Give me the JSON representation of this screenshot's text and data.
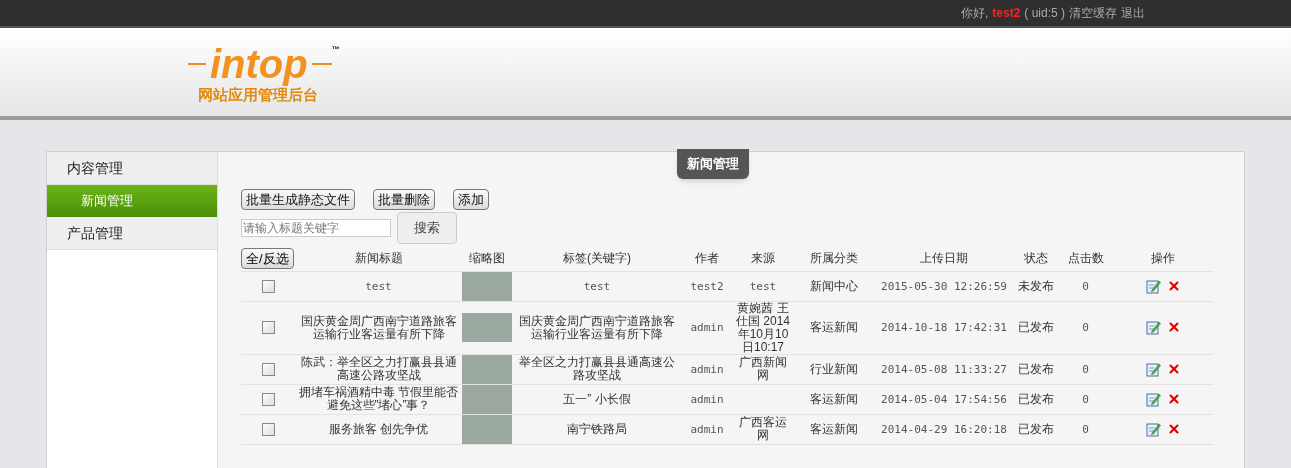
{
  "topbar": {
    "greeting": "你好,",
    "username": "test2",
    "uid": "( uid:5 )",
    "links": [
      "清空缓存",
      "退出"
    ]
  },
  "logo": {
    "name": "intop",
    "tm": "™",
    "subtitle": "网站应用管理后台"
  },
  "sidebar": {
    "groups": [
      {
        "label": "内容管理",
        "items": [
          {
            "label": "新闻管理",
            "selected": true
          }
        ]
      },
      {
        "label": "产品管理"
      }
    ]
  },
  "panel": {
    "title": "新闻管理"
  },
  "toolbar": {
    "buttons": [
      "批量生成静态文件",
      "批量删除",
      "添加"
    ],
    "search": {
      "placeholder": "请输入标题关键字",
      "button": "搜索"
    }
  },
  "table": {
    "select_all": "全/反选",
    "columns": [
      "新闻标题",
      "缩略图",
      "标签(关键字)",
      "作者",
      "来源",
      "所属分类",
      "上传日期",
      "状态",
      "点击数",
      "操作"
    ],
    "rows": [
      {
        "checked": false,
        "title": "test",
        "tags": "test",
        "author": "test2",
        "source": "test",
        "category": "新闻中心",
        "date": "2015-05-30 12:26:59",
        "status": "未发布",
        "clicks": "0"
      },
      {
        "checked": false,
        "title": "国庆黄金周广西南宁道路旅客运输行业客运量有所下降",
        "tags": "国庆黄金周广西南宁道路旅客运输行业客运量有所下降",
        "author": "admin",
        "source": "黄婉茜 王仕国 2014年10月10日10:17",
        "category": "客运新闻",
        "date": "2014-10-18 17:42:31",
        "status": "已发布",
        "clicks": "0"
      },
      {
        "checked": false,
        "title": "陈武：举全区之力打赢县县通高速公路攻坚战",
        "tags": "举全区之力打赢县县通高速公路攻坚战",
        "author": "admin",
        "source": "广西新闻网",
        "category": "行业新闻",
        "date": "2014-05-08 11:33:27",
        "status": "已发布",
        "clicks": "0"
      },
      {
        "checked": false,
        "title": "拥堵车祸酒精中毒 节假里能否避免这些”堵心”事？",
        "tags": "五一” 小长假",
        "author": "admin",
        "category": "客运新闻",
        "date": "2014-05-04 17:54:56",
        "status": "已发布",
        "clicks": "0"
      },
      {
        "checked": false,
        "title": "服务旅客 创先争优",
        "tags": "南宁铁路局",
        "author": "admin",
        "source": "广西客运网",
        "category": "客运新闻",
        "date": "2014-04-29 16:20:18",
        "status": "已发布",
        "clicks": "0"
      }
    ]
  }
}
